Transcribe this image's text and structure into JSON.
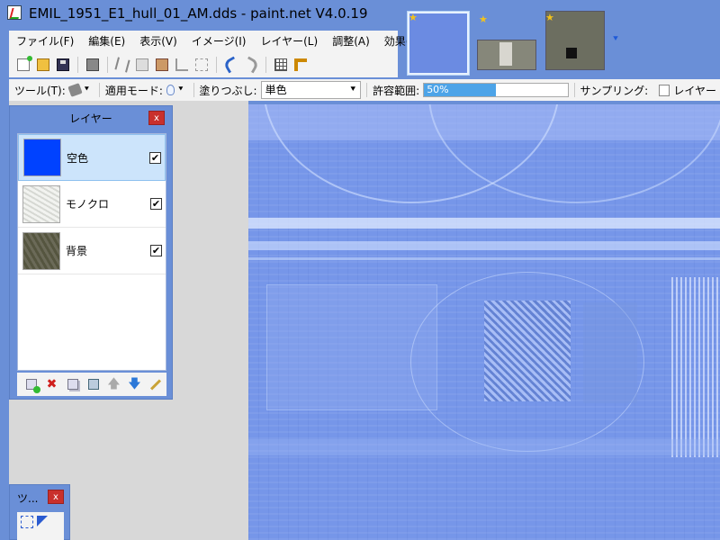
{
  "window": {
    "title": "EMIL_1951_E1_hull_01_AM.dds - paint.net V4.0.19"
  },
  "menu": [
    {
      "label": "ファイル(F)"
    },
    {
      "label": "編集(E)"
    },
    {
      "label": "表示(V)"
    },
    {
      "label": "イメージ(I)"
    },
    {
      "label": "レイヤー(L)"
    },
    {
      "label": "調整(A)"
    },
    {
      "label": "効果(C)"
    }
  ],
  "toolbar": {
    "icons": [
      "new-icon",
      "open-icon",
      "save-icon",
      "print-icon",
      "cut-icon",
      "copy-icon",
      "paste-icon",
      "crop-icon",
      "deselect-icon",
      "undo-icon",
      "redo-icon",
      "grid-icon",
      "ruler-icon"
    ]
  },
  "options": {
    "tool_label": "ツール(T):",
    "blend_mode_label": "適用モード:",
    "fill_label": "塗りつぶし:",
    "fill_value": "単色",
    "tolerance_label": "許容範囲:",
    "tolerance_value": "50%",
    "tolerance_fraction": 0.5,
    "sampling_label": "サンプリング:",
    "sampling_value": "レイヤー"
  },
  "layers_window": {
    "title": "レイヤー",
    "close": "x",
    "layers": [
      {
        "name": "空色",
        "visible": "✔",
        "thumb_color": "#0042ff"
      },
      {
        "name": "モノクロ",
        "visible": "✔",
        "thumb_color": "#e4e6e2"
      },
      {
        "name": "背景",
        "visible": "✔",
        "thumb_color": "#6b6a58"
      }
    ],
    "toolbar": {
      "delete": "✖",
      "up": "🡅",
      "down": "🡇"
    }
  },
  "tools_window": {
    "title": "ツ...",
    "close": "x"
  },
  "tabs": {
    "dropdown": "⯆",
    "star": "★"
  },
  "colors": {
    "accent": "#6a8fd7",
    "canvas_tint": "#7696e9",
    "selected_layer": "#cce4fb",
    "close_button": "#c9302c"
  }
}
